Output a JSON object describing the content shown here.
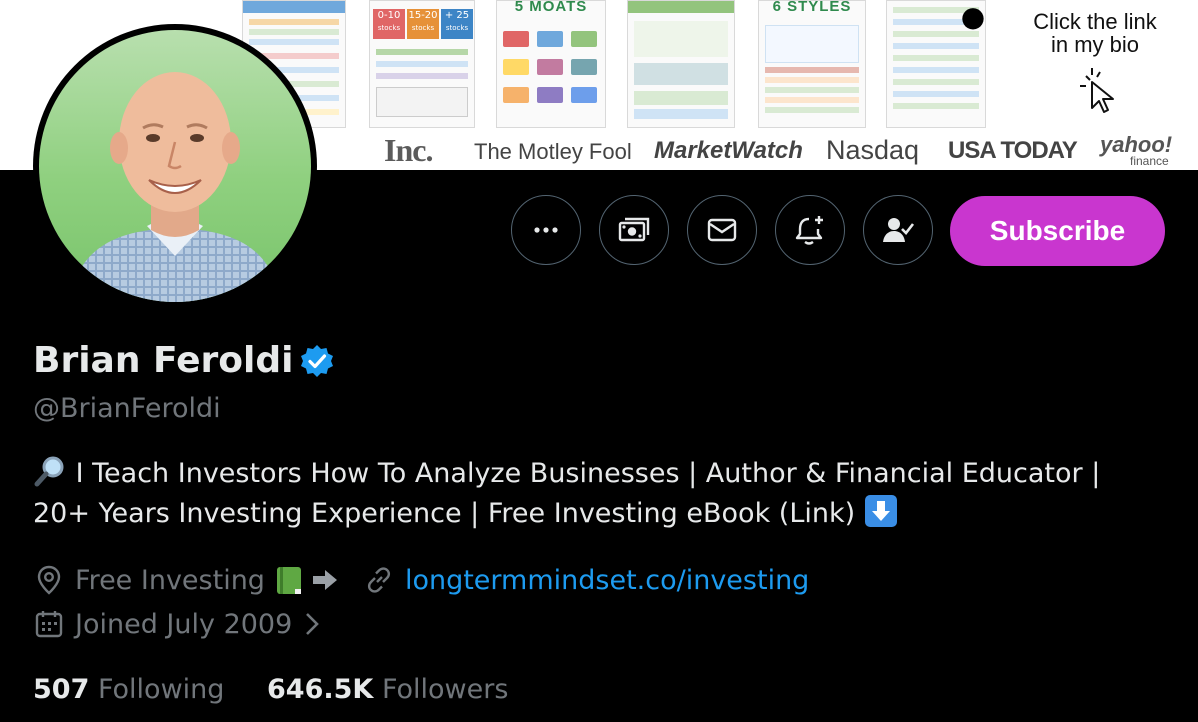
{
  "banner": {
    "thumb_titles": [
      "",
      "",
      "5 MOATS",
      "",
      "6 STYLES",
      ""
    ],
    "stock_buckets": [
      {
        "range": "0-10",
        "label": "stocks"
      },
      {
        "range": "15-20",
        "label": "stocks"
      },
      {
        "range": "+ 25",
        "label": "stocks"
      }
    ],
    "cta_line1": "Click the link",
    "cta_line2": "in my bio",
    "media_logos": [
      "Inc.",
      "The Motley Fool",
      "MarketWatch",
      "Nasdaq",
      "USA TODAY",
      "yahoo!",
      "finance"
    ]
  },
  "profile": {
    "name": "Brian Feroldi",
    "handle": "@BrianFeroldi",
    "bio_line1": "I Teach Investors How To Analyze Businesses | Author & Financial Educator |",
    "bio_line2": "20+ Years Investing Experience | Free Investing eBook (Link)",
    "location": "Free Investing",
    "website": "longtermmindset.co/investing",
    "joined": "Joined July 2009",
    "following_count": "507",
    "following_label": "Following",
    "followers_count": "646.5K",
    "followers_label": "Followers"
  },
  "actions": {
    "subscribe_label": "Subscribe"
  },
  "colors": {
    "subscribe_bg": "#c936cf",
    "link": "#1d9bf0",
    "verified": "#1d9bf0",
    "muted": "#71767b"
  },
  "icons": [
    "more-icon",
    "money-icon",
    "mail-icon",
    "bell-plus-icon",
    "following-user-icon",
    "verified-badge-icon",
    "magnifier-emoji",
    "green-book-emoji",
    "arrow-right-icon",
    "location-icon",
    "link-icon",
    "calendar-icon",
    "chevron-right-icon",
    "down-arrow-emoji",
    "apple-icon",
    "cursor-click-icon"
  ]
}
